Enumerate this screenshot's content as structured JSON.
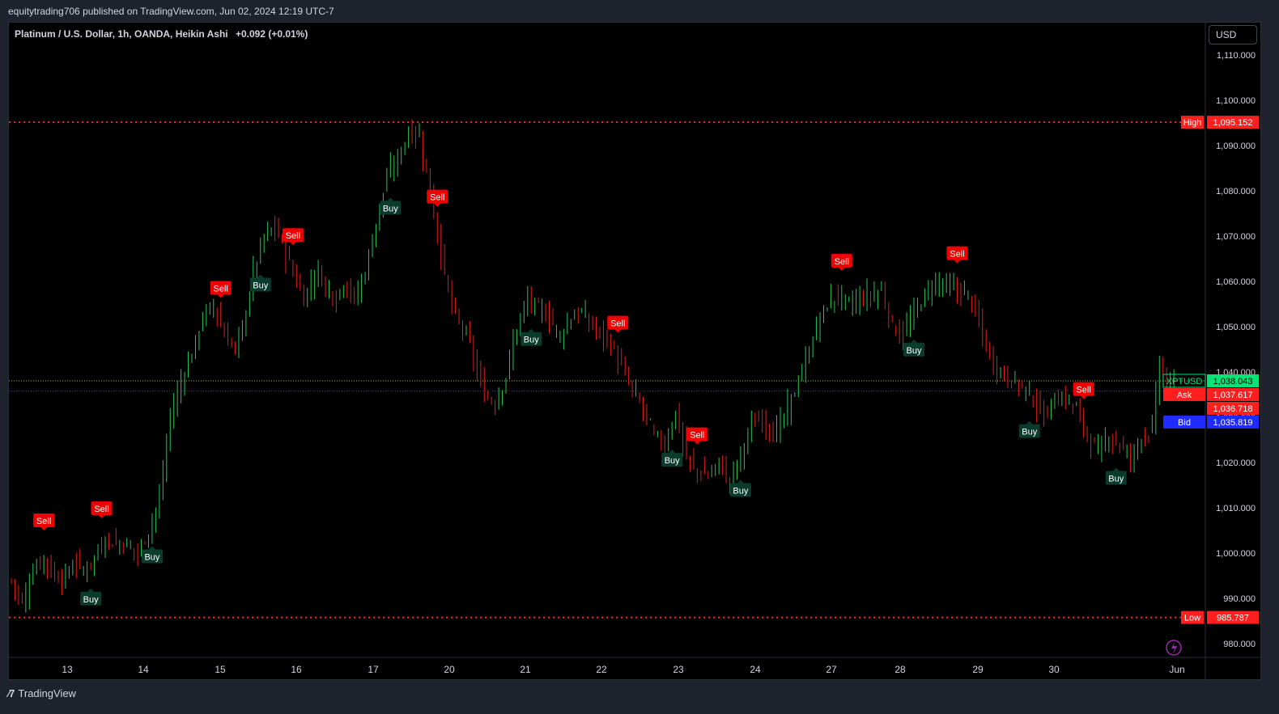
{
  "header": {
    "publisher_line": "equitytrading706 published on TradingView.com, Jun 02, 2024 12:19 UTC-7"
  },
  "legend": {
    "symbol_text": "Platinum / U.S. Dollar, 1h, OANDA, Heikin Ashi",
    "change_text": "+0.092 (+0.01%)"
  },
  "currency_selector": "USD",
  "footer": {
    "brand": "TradingView"
  },
  "colors": {
    "bull": "#22c55e",
    "bear": "#e11d1d",
    "sell_label": "#f00000",
    "buy_label": "#0b3b2c",
    "level_line": "#ff1f1f",
    "current_price": "#00e676",
    "bid": "#1f2bff",
    "background": "#000000"
  },
  "chart_data": {
    "type": "candlestick",
    "title": "Platinum / U.S. Dollar, 1h, OANDA, Heikin Ashi",
    "ylim": [
      975,
      1115
    ],
    "y_ticks": [
      {
        "value": 1110,
        "label": "1,110.000"
      },
      {
        "value": 1100,
        "label": "1,100.000"
      },
      {
        "value": 1090,
        "label": "1,090.000"
      },
      {
        "value": 1080,
        "label": "1,080.000"
      },
      {
        "value": 1070,
        "label": "1,070.000"
      },
      {
        "value": 1060,
        "label": "1,060.000"
      },
      {
        "value": 1050,
        "label": "1,050.000"
      },
      {
        "value": 1040,
        "label": "1,040.000"
      },
      {
        "value": 1030,
        "label": "1,030.000"
      },
      {
        "value": 1020,
        "label": "1,020.000"
      },
      {
        "value": 1010,
        "label": "1,010.000"
      },
      {
        "value": 1000,
        "label": "1,000.000"
      },
      {
        "value": 990,
        "label": "990.000"
      },
      {
        "value": 980,
        "label": "980.000"
      }
    ],
    "x_ticks": [
      "13",
      "14",
      "15",
      "16",
      "17",
      "20",
      "21",
      "22",
      "23",
      "24",
      "27",
      "28",
      "29",
      "30",
      "Jun"
    ],
    "high_line": {
      "label": "High",
      "value": 1095.152,
      "value_text": "1,095.152"
    },
    "low_line": {
      "label": "Low",
      "value": 985.787,
      "value_text": "985.787"
    },
    "last_price": {
      "symbol": "XPTUSD",
      "value": 1038.043,
      "value_text": "1,038.043"
    },
    "ask": {
      "label": "Ask",
      "value": 1037.617,
      "value_text": "1,037.617"
    },
    "mid": {
      "value": 1036.718,
      "value_text": "1,036.718"
    },
    "bid": {
      "label": "Bid",
      "value": 1035.819,
      "value_text": "1,035.819"
    },
    "anchors": [
      [
        0,
        994
      ],
      [
        3,
        989
      ],
      [
        6,
        996
      ],
      [
        9,
        999
      ],
      [
        11,
        996
      ],
      [
        14,
        994
      ],
      [
        18,
        998
      ],
      [
        20,
        996
      ],
      [
        23,
        999
      ],
      [
        26,
        1003
      ],
      [
        29,
        1002
      ],
      [
        32,
        1002
      ],
      [
        35,
        1000
      ],
      [
        38,
        1005
      ],
      [
        41,
        1012
      ],
      [
        44,
        1030
      ],
      [
        47,
        1038
      ],
      [
        50,
        1044
      ],
      [
        53,
        1052
      ],
      [
        56,
        1055
      ],
      [
        59,
        1048
      ],
      [
        62,
        1045
      ],
      [
        65,
        1053
      ],
      [
        67,
        1062
      ],
      [
        70,
        1070
      ],
      [
        73,
        1072
      ],
      [
        75,
        1068
      ],
      [
        77,
        1064
      ],
      [
        79,
        1060
      ],
      [
        81,
        1056
      ],
      [
        83,
        1060
      ],
      [
        85,
        1062
      ],
      [
        87,
        1059
      ],
      [
        90,
        1056
      ],
      [
        92,
        1060
      ],
      [
        95,
        1056
      ],
      [
        98,
        1062
      ],
      [
        101,
        1073
      ],
      [
        104,
        1083
      ],
      [
        107,
        1087
      ],
      [
        110,
        1093
      ],
      [
        113,
        1092
      ],
      [
        115,
        1084
      ],
      [
        117,
        1075
      ],
      [
        119,
        1066
      ],
      [
        121,
        1058
      ],
      [
        123,
        1052
      ],
      [
        125,
        1050
      ],
      [
        127,
        1046
      ],
      [
        129,
        1040
      ],
      [
        131,
        1035
      ],
      [
        134,
        1033
      ],
      [
        137,
        1039
      ],
      [
        140,
        1050
      ],
      [
        143,
        1056
      ],
      [
        146,
        1054
      ],
      [
        149,
        1052
      ],
      [
        152,
        1048
      ],
      [
        155,
        1052
      ],
      [
        158,
        1053
      ],
      [
        161,
        1050
      ],
      [
        164,
        1048
      ],
      [
        166,
        1046
      ],
      [
        169,
        1041
      ],
      [
        172,
        1036
      ],
      [
        175,
        1032
      ],
      [
        178,
        1026
      ],
      [
        181,
        1024
      ],
      [
        184,
        1031
      ],
      [
        187,
        1021
      ],
      [
        190,
        1018
      ],
      [
        193,
        1017
      ],
      [
        196,
        1020
      ],
      [
        199,
        1016
      ],
      [
        202,
        1022
      ],
      [
        205,
        1028
      ],
      [
        208,
        1030
      ],
      [
        211,
        1026
      ],
      [
        214,
        1030
      ],
      [
        217,
        1036
      ],
      [
        220,
        1042
      ],
      [
        223,
        1050
      ],
      [
        226,
        1055
      ],
      [
        229,
        1057
      ],
      [
        232,
        1055
      ],
      [
        235,
        1056
      ],
      [
        238,
        1057
      ],
      [
        241,
        1058
      ],
      [
        244,
        1050
      ],
      [
        247,
        1048
      ],
      [
        250,
        1053
      ],
      [
        253,
        1057
      ],
      [
        256,
        1060
      ],
      [
        259,
        1059
      ],
      [
        262,
        1058
      ],
      [
        265,
        1057
      ],
      [
        268,
        1051
      ],
      [
        271,
        1043
      ],
      [
        274,
        1040
      ],
      [
        277,
        1038
      ],
      [
        280,
        1037
      ],
      [
        283,
        1034
      ],
      [
        286,
        1030
      ],
      [
        289,
        1034
      ],
      [
        292,
        1034
      ],
      [
        295,
        1032
      ],
      [
        298,
        1026
      ],
      [
        301,
        1022
      ],
      [
        304,
        1026
      ],
      [
        307,
        1024
      ],
      [
        310,
        1021
      ],
      [
        313,
        1026
      ],
      [
        316,
        1027
      ],
      [
        318,
        1043
      ],
      [
        320,
        1036
      ],
      [
        322,
        1038
      ]
    ],
    "signals": [
      {
        "type": "sell",
        "label": "Sell",
        "bar": 9
      },
      {
        "type": "buy",
        "label": "Buy",
        "bar": 22
      },
      {
        "type": "sell",
        "label": "Sell",
        "bar": 25
      },
      {
        "type": "buy",
        "label": "Buy",
        "bar": 39
      },
      {
        "type": "sell",
        "label": "Sell",
        "bar": 58
      },
      {
        "type": "buy",
        "label": "Buy",
        "bar": 69
      },
      {
        "type": "sell",
        "label": "Sell",
        "bar": 78
      },
      {
        "type": "buy",
        "label": "Buy",
        "bar": 105
      },
      {
        "type": "sell",
        "label": "Sell",
        "bar": 118
      },
      {
        "type": "buy",
        "label": "Buy",
        "bar": 144
      },
      {
        "type": "sell",
        "label": "Sell",
        "bar": 168
      },
      {
        "type": "buy",
        "label": "Buy",
        "bar": 183
      },
      {
        "type": "sell",
        "label": "Sell",
        "bar": 190
      },
      {
        "type": "buy",
        "label": "Buy",
        "bar": 202
      },
      {
        "type": "sell",
        "label": "Sell",
        "bar": 230
      },
      {
        "type": "buy",
        "label": "Buy",
        "bar": 250
      },
      {
        "type": "sell",
        "label": "Sell",
        "bar": 262
      },
      {
        "type": "buy",
        "label": "Buy",
        "bar": 282
      },
      {
        "type": "sell",
        "label": "Sell",
        "bar": 297
      },
      {
        "type": "buy",
        "label": "Buy",
        "bar": 306
      }
    ]
  }
}
